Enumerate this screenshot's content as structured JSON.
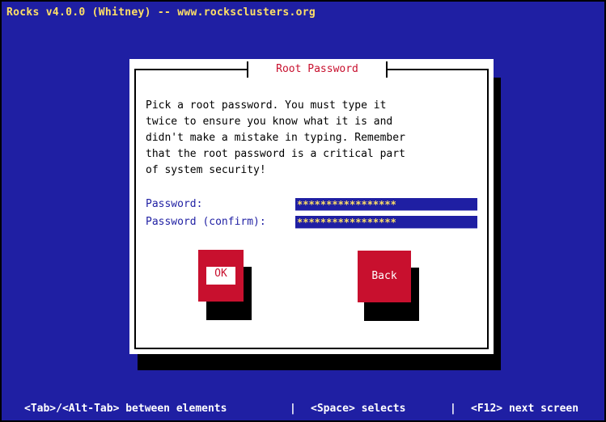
{
  "header": {
    "title": "Rocks v4.0.0 (Whitney) -- www.rocksclusters.org"
  },
  "dialog": {
    "title": "Root Password",
    "instructions": "Pick a root password. You must type it\ntwice to ensure you know what it is and\ndidn't make a mistake in typing. Remember\nthat the root password is a critical part\nof system security!",
    "password_label": "Password:",
    "password_value": "*****************",
    "confirm_label": "Password (confirm):",
    "confirm_value": "*****************",
    "ok_label": "OK",
    "back_label": "Back"
  },
  "status_bar": {
    "tab_hint": "<Tab>/<Alt-Tab> between elements",
    "separator": "|",
    "space_hint": "<Space> selects",
    "f12_hint": "<F12> next screen"
  },
  "colors": {
    "background": "#1f1fa3",
    "header_text": "#ffe066",
    "accent_red": "#c8102e",
    "dialog_bg": "#ffffff"
  }
}
